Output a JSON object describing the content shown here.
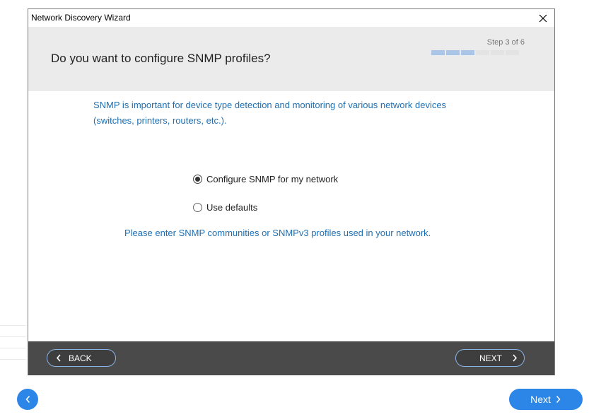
{
  "window": {
    "title": "Network Discovery Wizard"
  },
  "header": {
    "heading": "Do you want to configure SNMP profiles?",
    "step_text": "Step 3 of 6",
    "progress": {
      "current": 3,
      "total": 6
    }
  },
  "content": {
    "intro": "SNMP is important for device type detection and monitoring of various network devices (switches, printers, routers, etc.).",
    "options": [
      {
        "label": "Configure SNMP for my network",
        "selected": true
      },
      {
        "label": "Use defaults",
        "selected": false
      }
    ],
    "hint": "Please enter SNMP communities or SNMPv3 profiles used in your network."
  },
  "footer": {
    "back_label": "BACK",
    "next_label": "NEXT"
  },
  "outer": {
    "next_label": "Next"
  },
  "colors": {
    "accent_text": "#1f6fb2",
    "footer_bg": "#4a4a4a",
    "outer_button": "#2b86e8",
    "progress_done": "#a9c6e8"
  }
}
